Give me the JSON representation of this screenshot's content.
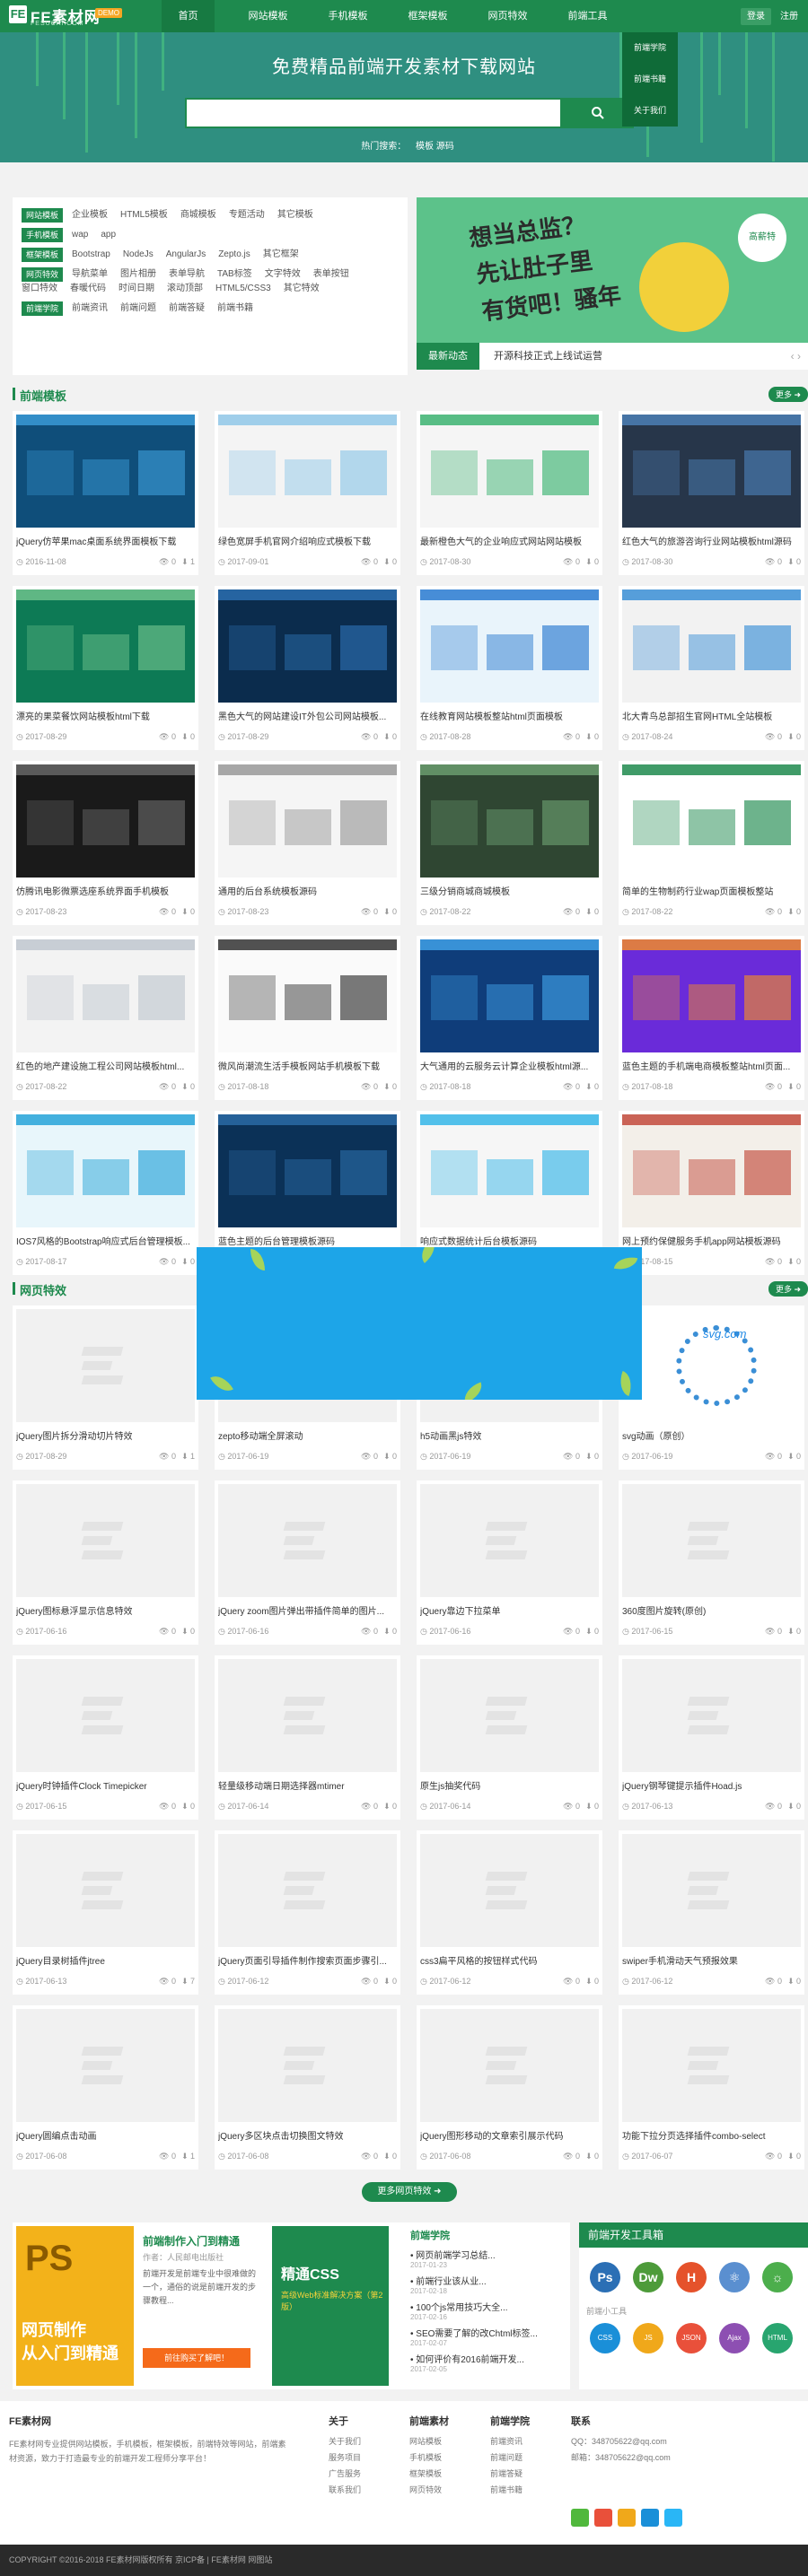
{
  "header": {
    "logo_mark": "FE",
    "logo_title": "FE素材网",
    "logo_badge": "DEMO",
    "logo_domain": "FESUCAI.COM",
    "nav": [
      "首页",
      "网站模板",
      "手机模板",
      "框架模板",
      "网页特效",
      "前端工具"
    ],
    "login": "登录",
    "register": "注册",
    "dropdown": [
      "前端学院",
      "前端书籍",
      "关于我们"
    ]
  },
  "hero": {
    "title": "免费精品前端开发素材下载网站",
    "search_placeholder": "",
    "hot": [
      "热门搜索：",
      "模板",
      "源码"
    ]
  },
  "categories": [
    {
      "label": "网站模板",
      "links": [
        "企业模板",
        "HTML5模板",
        "商城模板",
        "专题活动",
        "其它模板"
      ]
    },
    {
      "label": "手机模板",
      "links": [
        "wap",
        "app"
      ]
    },
    {
      "label": "框架模板",
      "links": [
        "Bootstrap",
        "NodeJs",
        "AngularJs",
        "Zepto.js",
        "其它框架"
      ]
    },
    {
      "label": "网页特效",
      "links": [
        "导航菜单",
        "图片相册",
        "表单导航",
        "TAB标签",
        "文字特效",
        "表单按钮",
        "窗口特效",
        "春暖代码",
        "时间日期",
        "滚动顶部",
        "HTML5/CSS3",
        "其它特效"
      ]
    },
    {
      "label": "前端学院",
      "links": [
        "前端资讯",
        "前端问题",
        "前端答疑",
        "前端书籍"
      ]
    }
  ],
  "banner": {
    "line1": "想当总监？",
    "line2": "先让肚子里",
    "line3": "有货吧！骚年",
    "stamp": "高薪特"
  },
  "news": {
    "label": "最新动态",
    "text": "开源科技正式上线试运营",
    "arrows": "‹ ›"
  },
  "sections": {
    "templates": {
      "title": "前端模板",
      "more": "更多 ➜"
    },
    "effects": {
      "title": "网页特效",
      "more": "更多 ➜"
    }
  },
  "templates": [
    {
      "title": "jQuery仿苹果mac桌面系统界面模板下载",
      "date": "2016-11-08",
      "views": "0",
      "downloads": "1"
    },
    {
      "title": "绿色宽屏手机官网介绍响应式模板下载",
      "date": "2017-09-01",
      "views": "0",
      "downloads": "0"
    },
    {
      "title": "最新橙色大气的企业响应式网站网站模板",
      "date": "2017-08-30",
      "views": "0",
      "downloads": "0"
    },
    {
      "title": "红色大气的旅游咨询行业网站模板html源码",
      "date": "2017-08-30",
      "views": "0",
      "downloads": "0"
    },
    {
      "title": "漂亮的果菜餐饮网站模板html下载",
      "date": "2017-08-29",
      "views": "0",
      "downloads": "0"
    },
    {
      "title": "黑色大气的网站建设IT外包公司网站模板...",
      "date": "2017-08-29",
      "views": "0",
      "downloads": "0"
    },
    {
      "title": "在线教育网站模板整站html页面模板",
      "date": "2017-08-28",
      "views": "0",
      "downloads": "0"
    },
    {
      "title": "北大青鸟总部招生官网HTML全站模板",
      "date": "2017-08-24",
      "views": "0",
      "downloads": "0"
    },
    {
      "title": "仿腾讯电影微票选座系统界面手机模板",
      "date": "2017-08-23",
      "views": "0",
      "downloads": "0"
    },
    {
      "title": "通用的后台系统模板源码",
      "date": "2017-08-23",
      "views": "0",
      "downloads": "0"
    },
    {
      "title": "三级分销商城商城模板",
      "date": "2017-08-22",
      "views": "0",
      "downloads": "0"
    },
    {
      "title": "简单的生物制药行业wap页面模板整站",
      "date": "2017-08-22",
      "views": "0",
      "downloads": "0"
    },
    {
      "title": "红色的地产建设施工程公司网站模板html...",
      "date": "2017-08-22",
      "views": "0",
      "downloads": "0"
    },
    {
      "title": "微风尚潮流生活手模板网站手机模板下载",
      "date": "2017-08-18",
      "views": "0",
      "downloads": "0"
    },
    {
      "title": "大气通用的云服务云计算企业模板html源...",
      "date": "2017-08-18",
      "views": "0",
      "downloads": "0"
    },
    {
      "title": "蓝色主题的手机端电商模板整站html页面...",
      "date": "2017-08-18",
      "views": "0",
      "downloads": "0"
    },
    {
      "title": "IOS7风格的Bootstrap响应式后台管理模板...",
      "date": "2017-08-17",
      "views": "0",
      "downloads": "0"
    },
    {
      "title": "蓝色主题的后台管理模板源码",
      "date": "2017-08-16",
      "views": "0",
      "downloads": "0"
    },
    {
      "title": "响应式数据统计后台模板源码",
      "date": "2017-08-16",
      "views": "0",
      "downloads": "0"
    },
    {
      "title": "网上预约保健服务手机app网站模板源码",
      "date": "2017-08-15",
      "views": "0",
      "downloads": "0"
    }
  ],
  "effects": [
    {
      "title": "jQuery图片拆分滑动切片特效",
      "date": "2017-08-29",
      "views": "0",
      "downloads": "1"
    },
    {
      "title": "zepto移动端全屏滚动",
      "date": "2017-06-19",
      "views": "0",
      "downloads": "0"
    },
    {
      "title": "h5动画黑js特效",
      "date": "2017-06-19",
      "views": "0",
      "downloads": "0"
    },
    {
      "title": "svg动画（原创）",
      "date": "2017-06-19",
      "views": "0",
      "downloads": "0"
    },
    {
      "title": "jQuery图标悬浮显示信息特效",
      "date": "2017-06-16",
      "views": "0",
      "downloads": "0"
    },
    {
      "title": "jQuery zoom图片弹出带插件简单的图片...",
      "date": "2017-06-16",
      "views": "0",
      "downloads": "0"
    },
    {
      "title": "jQuery靠边下拉菜单",
      "date": "2017-06-16",
      "views": "0",
      "downloads": "0"
    },
    {
      "title": "360度图片旋转(原创)",
      "date": "2017-06-15",
      "views": "0",
      "downloads": "0"
    },
    {
      "title": "jQuery时钟插件Clock Timepicker",
      "date": "2017-06-15",
      "views": "0",
      "downloads": "0"
    },
    {
      "title": "轻量级移动端日期选择器mtimer",
      "date": "2017-06-14",
      "views": "0",
      "downloads": "0"
    },
    {
      "title": "原生js抽奖代码",
      "date": "2017-06-14",
      "views": "0",
      "downloads": "0"
    },
    {
      "title": "jQuery钢琴键提示插件Hoad.js",
      "date": "2017-06-13",
      "views": "0",
      "downloads": "0"
    },
    {
      "title": "jQuery目录树插件jtree",
      "date": "2017-06-13",
      "views": "0",
      "downloads": "7"
    },
    {
      "title": "jQuery页面引导插件制作搜索页面步骤引...",
      "date": "2017-06-12",
      "views": "0",
      "downloads": "0"
    },
    {
      "title": "css3扁平风格的按钮样式代码",
      "date": "2017-06-12",
      "views": "0",
      "downloads": "0"
    },
    {
      "title": "swiper手机滑动天气预报效果",
      "date": "2017-06-12",
      "views": "0",
      "downloads": "0"
    },
    {
      "title": "jQuery圆编点击动画",
      "date": "2017-06-08",
      "views": "0",
      "downloads": "1"
    },
    {
      "title": "jQuery多区块点击切换图文特效",
      "date": "2017-06-08",
      "views": "0",
      "downloads": "0"
    },
    {
      "title": "jQuery图形移动的文章索引展示代码",
      "date": "2017-06-08",
      "views": "0",
      "downloads": "0"
    },
    {
      "title": "功能下拉分页选择插件combo-select",
      "date": "2017-06-07",
      "views": "0",
      "downloads": "0"
    }
  ],
  "more_effects": "更多网页特效 ➜",
  "course": {
    "cover_text": "PS",
    "cover_line1": "网页制作",
    "cover_line2": "从入门到精通",
    "title": "前端制作入门到精通",
    "author": "作者：人民邮电出版社",
    "desc": "前端开发是前端专业中很难做的一个，通俗的说是前端开发的步骤教程...",
    "button": "前往购买了解吧！",
    "book_title": "精通CSS",
    "book_sub": "高级Web标准解决方案（第2版）"
  },
  "articles": {
    "title": "前端学院",
    "items": [
      {
        "title": "网页前端学习总结...",
        "date": "2017-01-23"
      },
      {
        "title": "前端行业该从业...",
        "date": "2017-02-18"
      },
      {
        "title": "100个js常用技巧大全...",
        "date": "2017-02-16"
      },
      {
        "title": "SEO需要了解的改Chtml标签...",
        "date": "2017-02-07"
      },
      {
        "title": "如何评价有2016前端开发...",
        "date": "2017-02-05"
      }
    ]
  },
  "tools": {
    "title": "前端开发工具箱",
    "icons": [
      {
        "name": "Ps",
        "color": "#2b6fb5"
      },
      {
        "name": "Dw",
        "color": "#4d9b3a"
      },
      {
        "name": "H",
        "color": "#e5522b"
      },
      {
        "name": "⚛",
        "color": "#5a8fd0"
      },
      {
        "name": "☼",
        "color": "#4cae4c"
      }
    ],
    "subtitle": "前端小工具",
    "small": [
      {
        "name": "CSS",
        "color": "#1a8fd8"
      },
      {
        "name": "JS",
        "color": "#f0a81a"
      },
      {
        "name": "JSON",
        "color": "#e9503a"
      },
      {
        "name": "Ajax",
        "color": "#8d4fb2"
      },
      {
        "name": "HTML",
        "color": "#28a56f"
      }
    ]
  },
  "footer": {
    "brand": "FE素材网",
    "desc": "FE素材网专业提供网站模板，手机模板，框架模板，前端特效等网站，前端素材资源，致力于打造最专业的前端开发工程师分享平台！",
    "about_title": "关于",
    "about_links": [
      "关于我们",
      "服务项目",
      "广告服务",
      "联系我们"
    ],
    "front_title": "前端素材",
    "front_links": [
      "网站模板",
      "手机模板",
      "框架模板",
      "网页特效"
    ],
    "school_title": "前端学院",
    "school_links": [
      "前端资讯",
      "前端问题",
      "前端答疑",
      "前端书籍"
    ],
    "contact_title": "联系",
    "contact_links": [
      "QQ：348705622@qq.com",
      "邮箱：348705622@qq.com"
    ],
    "social_colors": [
      "#50b83c",
      "#e9503a",
      "#f0a81a",
      "#1a8fd8",
      "#29b6f6"
    ]
  },
  "copyright": "COPYRIGHT ©2016-2018 FE素材网版权所有 京ICP备 | FE素材网 网图站"
}
